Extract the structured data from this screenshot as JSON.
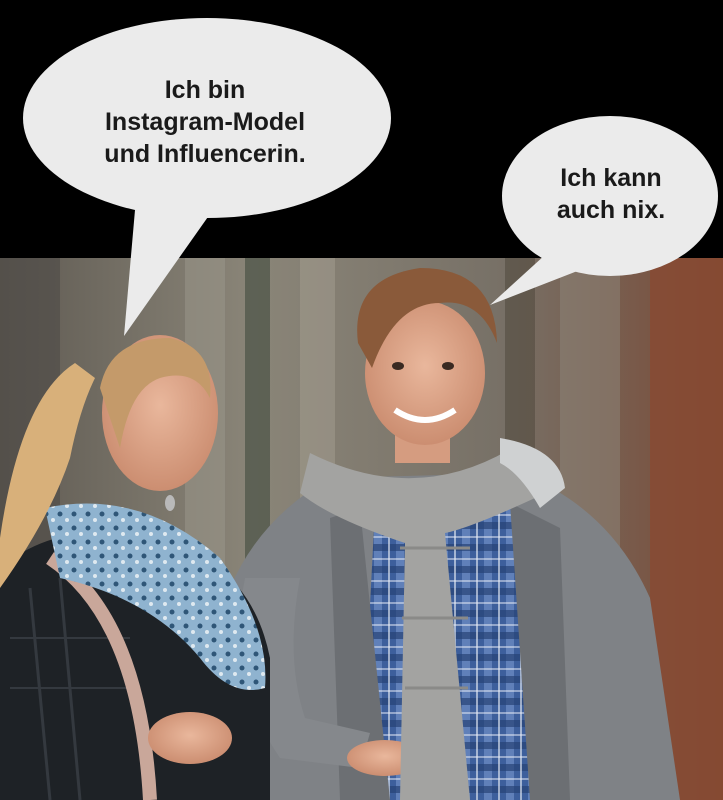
{
  "bubbles": {
    "woman": {
      "line1": "Ich bin",
      "line2": "Instagram-Model",
      "line3": "und Influencerin."
    },
    "man": {
      "line1": "Ich kann",
      "line2": "auch nix."
    }
  },
  "colors": {
    "background": "#000000",
    "bubble": "#ebebeb"
  }
}
